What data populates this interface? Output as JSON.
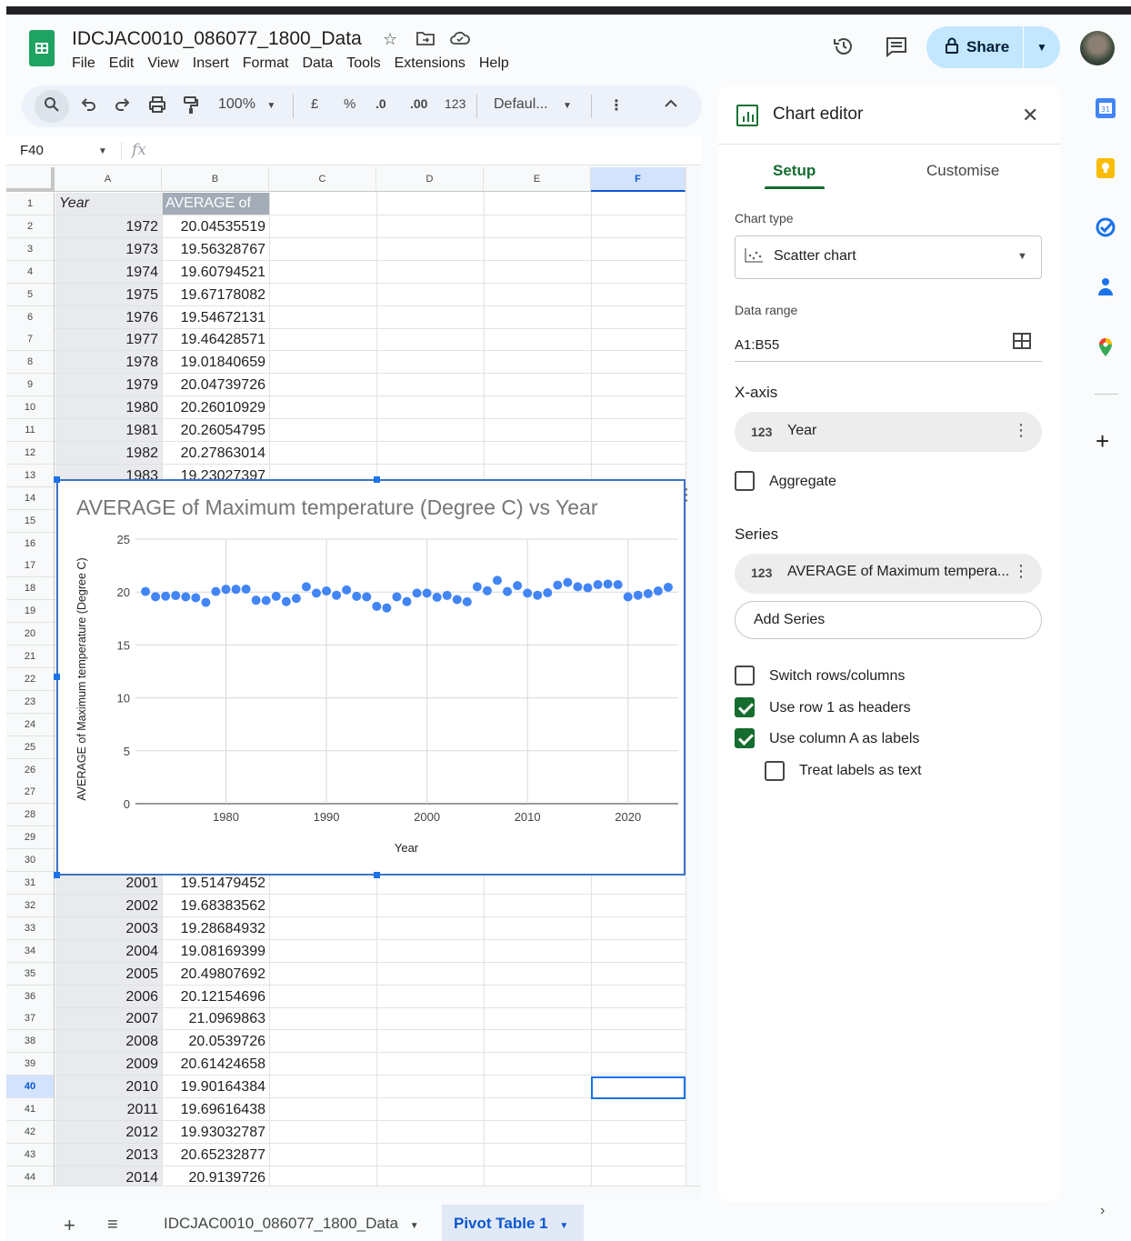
{
  "document": {
    "title": "IDCJAC0010_086077_1800_Data",
    "menu": [
      "File",
      "Edit",
      "View",
      "Insert",
      "Format",
      "Data",
      "Tools",
      "Extensions",
      "Help"
    ],
    "share_label": "Share"
  },
  "toolbar": {
    "zoom": "100%",
    "currency": "£",
    "percent": "%",
    "dec_decrease": ".0",
    "dec_increase": ".00",
    "number_format": "123",
    "font": "Defaul..."
  },
  "formula_bar": {
    "name_box": "F40",
    "fx": "fx",
    "formula": ""
  },
  "sheet": {
    "columns": [
      "A",
      "B",
      "C",
      "D",
      "E",
      "F"
    ],
    "selected_column": "F",
    "selected_row": 40,
    "header_row": [
      "Year",
      "AVERAGE of Maximum temperature (Degree C)"
    ],
    "header_b_visible": "AVERAGE of Ma",
    "rows_top": [
      {
        "row": 2,
        "year": "1972",
        "value": "20.04535519"
      },
      {
        "row": 3,
        "year": "1973",
        "value": "19.56328767"
      },
      {
        "row": 4,
        "year": "1974",
        "value": "19.60794521"
      },
      {
        "row": 5,
        "year": "1975",
        "value": "19.67178082"
      },
      {
        "row": 6,
        "year": "1976",
        "value": "19.54672131"
      },
      {
        "row": 7,
        "year": "1977",
        "value": "19.46428571"
      },
      {
        "row": 8,
        "year": "1978",
        "value": "19.01840659"
      },
      {
        "row": 9,
        "year": "1979",
        "value": "20.04739726"
      },
      {
        "row": 10,
        "year": "1980",
        "value": "20.26010929"
      },
      {
        "row": 11,
        "year": "1981",
        "value": "20.26054795"
      },
      {
        "row": 12,
        "year": "1982",
        "value": "20.27863014"
      },
      {
        "row": 13,
        "year": "1983",
        "value": "19.23027397"
      }
    ],
    "rows_bottom": [
      {
        "row": 31,
        "year": "2001",
        "value": "19.51479452"
      },
      {
        "row": 32,
        "year": "2002",
        "value": "19.68383562"
      },
      {
        "row": 33,
        "year": "2003",
        "value": "19.28684932"
      },
      {
        "row": 34,
        "year": "2004",
        "value": "19.08169399"
      },
      {
        "row": 35,
        "year": "2005",
        "value": "20.49807692"
      },
      {
        "row": 36,
        "year": "2006",
        "value": "20.12154696"
      },
      {
        "row": 37,
        "year": "2007",
        "value": "21.0969863"
      },
      {
        "row": 38,
        "year": "2008",
        "value": "20.0539726"
      },
      {
        "row": 39,
        "year": "2009",
        "value": "20.61424658"
      },
      {
        "row": 40,
        "year": "2010",
        "value": "19.90164384"
      },
      {
        "row": 41,
        "year": "2011",
        "value": "19.69616438"
      },
      {
        "row": 42,
        "year": "2012",
        "value": "19.93032787"
      },
      {
        "row": 43,
        "year": "2013",
        "value": "20.65232877"
      },
      {
        "row": 44,
        "year": "2014",
        "value": "20.9139726"
      }
    ]
  },
  "chart_data": {
    "type": "scatter",
    "title": "AVERAGE of Maximum temperature (Degree C) vs Year",
    "xlabel": "Year",
    "ylabel": "AVERAGE of Maximum temperature (Degree C)",
    "xlim": [
      1971,
      2025
    ],
    "ylim": [
      0,
      25
    ],
    "xticks": [
      1980,
      1990,
      2000,
      2010,
      2020
    ],
    "yticks": [
      0,
      5,
      10,
      15,
      20,
      25
    ],
    "grid": true,
    "point_color": "#4285f4",
    "series": [
      {
        "x": [
          1972,
          1973,
          1974,
          1975,
          1976,
          1977,
          1978,
          1979,
          1980,
          1981,
          1982,
          1983,
          1984,
          1985,
          1986,
          1987,
          1988,
          1989,
          1990,
          1991,
          1992,
          1993,
          1994,
          1995,
          1996,
          1997,
          1998,
          1999,
          2000,
          2001,
          2002,
          2003,
          2004,
          2005,
          2006,
          2007,
          2008,
          2009,
          2010,
          2011,
          2012,
          2013,
          2014,
          2015,
          2016,
          2017,
          2018,
          2019,
          2020,
          2021,
          2022,
          2023,
          2024
        ],
        "y": [
          20.05,
          19.56,
          19.61,
          19.67,
          19.55,
          19.46,
          19.02,
          20.05,
          20.26,
          20.26,
          20.28,
          19.23,
          19.2,
          19.6,
          19.1,
          19.4,
          20.5,
          19.9,
          20.1,
          19.7,
          20.2,
          19.6,
          19.55,
          18.65,
          18.5,
          19.55,
          19.1,
          19.9,
          19.9,
          19.51,
          19.68,
          19.29,
          19.08,
          20.5,
          20.12,
          21.1,
          20.05,
          20.61,
          19.9,
          19.7,
          19.93,
          20.65,
          20.91,
          20.5,
          20.4,
          20.7,
          20.75,
          20.7,
          19.55,
          19.7,
          19.85,
          20.1,
          20.45
        ]
      }
    ]
  },
  "chart_editor": {
    "title": "Chart editor",
    "tabs": [
      "Setup",
      "Customise"
    ],
    "chart_type_label": "Chart type",
    "chart_type_value": "Scatter chart",
    "data_range_label": "Data range",
    "data_range_value": "A1:B55",
    "x_axis_label": "X-axis",
    "x_axis_value": "Year",
    "aggregate_label": "Aggregate",
    "series_label": "Series",
    "series_value": "AVERAGE of Maximum tempera...",
    "add_series": "Add Series",
    "chip_icon": "123",
    "options": [
      {
        "label": "Switch rows/columns",
        "checked": false
      },
      {
        "label": "Use row 1 as headers",
        "checked": true
      },
      {
        "label": "Use column A as labels",
        "checked": true
      },
      {
        "label": "Treat labels as text",
        "checked": false
      }
    ]
  },
  "sheet_tabs": {
    "tabs": [
      "IDCJAC0010_086077_1800_Data",
      "Pivot Table 1"
    ],
    "active": "Pivot Table 1"
  },
  "side_apps": [
    "calendar-icon",
    "keep-icon",
    "tasks-icon",
    "contacts-icon",
    "maps-icon"
  ],
  "colors": {
    "accent_green": "#146c2e",
    "share_bg": "#c2e7ff",
    "selection_blue": "#0b57d0"
  }
}
